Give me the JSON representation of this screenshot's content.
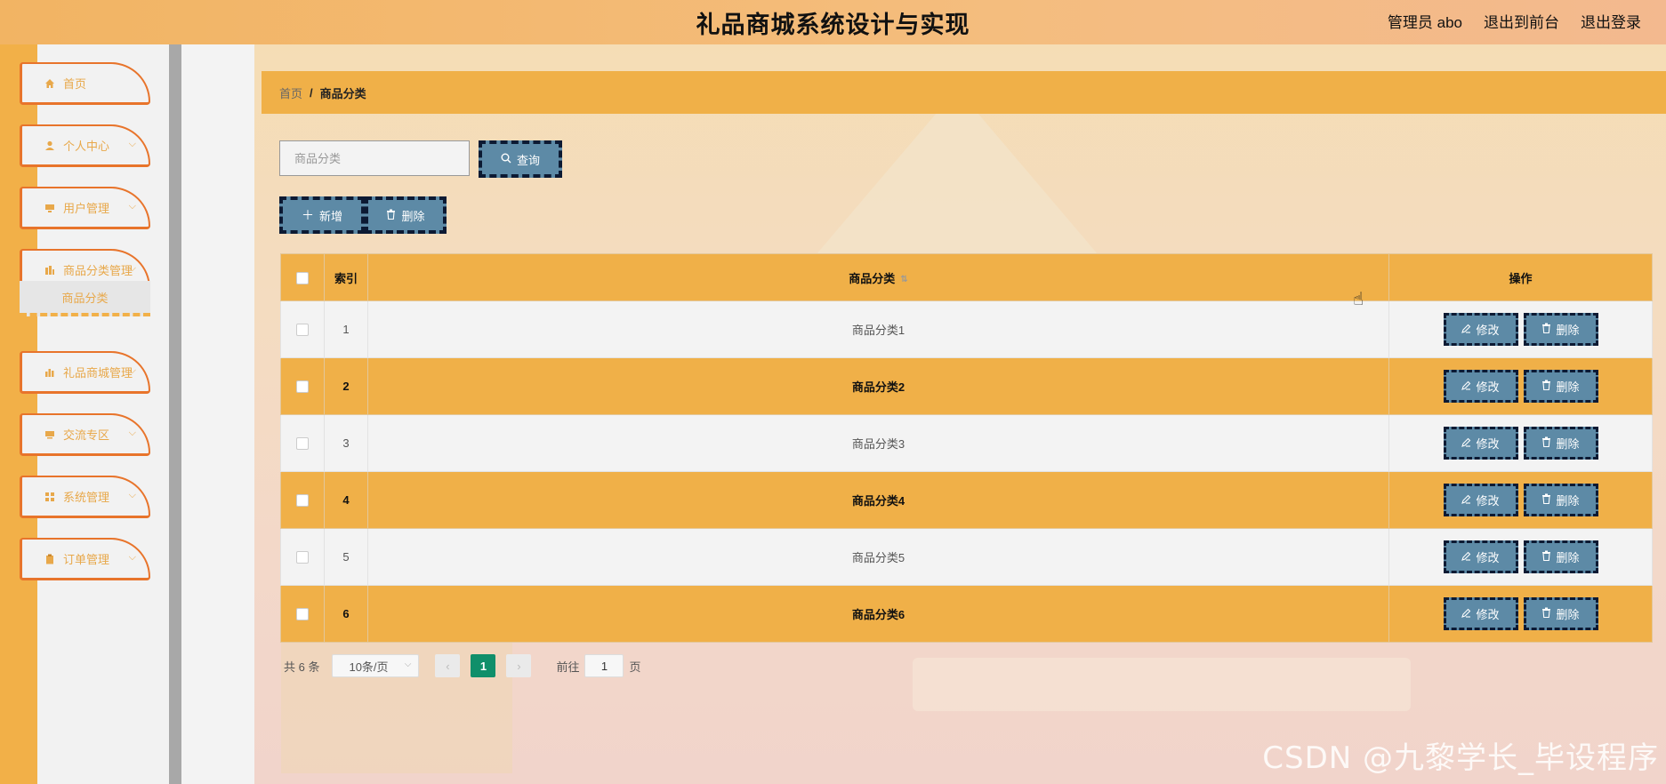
{
  "header": {
    "title": "礼品商城系统设计与实现",
    "admin_label": "管理员 abo",
    "front_link": "退出到前台",
    "logout_link": "退出登录"
  },
  "sidebar": {
    "items": [
      {
        "label": "首页",
        "icon": "home-icon",
        "has_children": false
      },
      {
        "label": "个人中心",
        "icon": "user-icon",
        "has_children": true
      },
      {
        "label": "用户管理",
        "icon": "users-icon",
        "has_children": true
      },
      {
        "label": "商品分类管理",
        "icon": "chart-bar-icon",
        "has_children": true
      },
      {
        "label": "礼品商城管理",
        "icon": "chart-bar-icon",
        "has_children": true
      },
      {
        "label": "交流专区",
        "icon": "monitor-icon",
        "has_children": true
      },
      {
        "label": "系统管理",
        "icon": "grid-icon",
        "has_children": true
      },
      {
        "label": "订单管理",
        "icon": "clipboard-icon",
        "has_children": true
      }
    ],
    "active_sub": "商品分类"
  },
  "breadcrumb": {
    "home": "首页",
    "separator": "/",
    "current": "商品分类"
  },
  "search": {
    "placeholder": "商品分类",
    "query_label": "查询"
  },
  "actions": {
    "add_label": "新增",
    "delete_label": "删除"
  },
  "table": {
    "headers": {
      "index": "索引",
      "category": "商品分类",
      "ops": "操作"
    },
    "rows": [
      {
        "index": "1",
        "category": "商品分类1"
      },
      {
        "index": "2",
        "category": "商品分类2"
      },
      {
        "index": "3",
        "category": "商品分类3"
      },
      {
        "index": "4",
        "category": "商品分类4"
      },
      {
        "index": "5",
        "category": "商品分类5"
      },
      {
        "index": "6",
        "category": "商品分类6"
      }
    ],
    "edit_label": "修改",
    "delete_label": "删除"
  },
  "pagination": {
    "total": "共 6 条",
    "page_size": "10条/页",
    "current_page": "1",
    "goto_label": "前往",
    "goto_value": "1",
    "page_unit": "页"
  },
  "watermark": "CSDN @九黎学长_毕设程序",
  "colors": {
    "primary_orange": "#f0b048",
    "button_blue": "#5d8aa6",
    "menu_border": "#e8742b",
    "pager_active": "#108f6a"
  }
}
